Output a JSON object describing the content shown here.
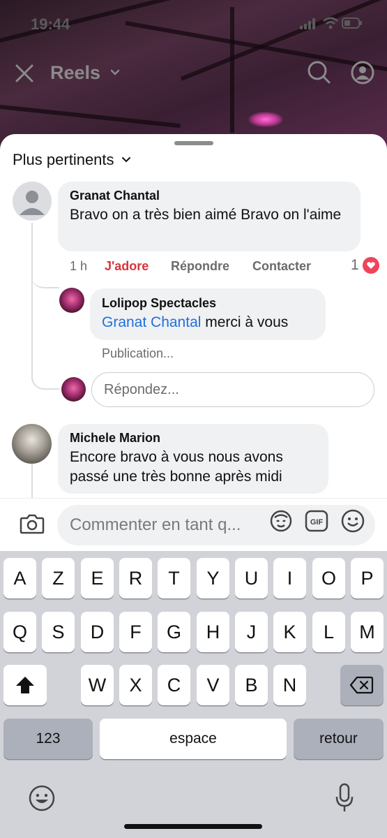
{
  "status": {
    "time": "19:44"
  },
  "nav": {
    "title": "Reels"
  },
  "sort": {
    "label": "Plus pertinents"
  },
  "comments": [
    {
      "author": "Granat Chantal",
      "text": "Bravo  on a très bien  aimé  Bravo  on l'aime",
      "time": "1 h",
      "like_label": "J'adore",
      "reply_label": "Répondre",
      "contact_label": "Contacter",
      "reaction_count": "1"
    },
    {
      "author": "Lolipop Spectacles",
      "mention": "Granat Chantal",
      "text": " merci à vous",
      "meta": "Publication..."
    },
    {
      "author": "Michele Marion",
      "text": "Encore bravo à vous  nous avons passé une très bonne après midi"
    }
  ],
  "reply_placeholder": "Répondez...",
  "composer": {
    "placeholder": "Commenter en tant q..."
  },
  "keyboard": {
    "row1": [
      "A",
      "Z",
      "E",
      "R",
      "T",
      "Y",
      "U",
      "I",
      "O",
      "P"
    ],
    "row2": [
      "Q",
      "S",
      "D",
      "F",
      "G",
      "H",
      "J",
      "K",
      "L",
      "M"
    ],
    "row3": [
      "W",
      "X",
      "C",
      "V",
      "B",
      "N"
    ],
    "numbers": "123",
    "space": "espace",
    "return": "retour"
  },
  "colors": {
    "accent_red": "#d8343a",
    "mention_blue": "#1f6fdc"
  }
}
